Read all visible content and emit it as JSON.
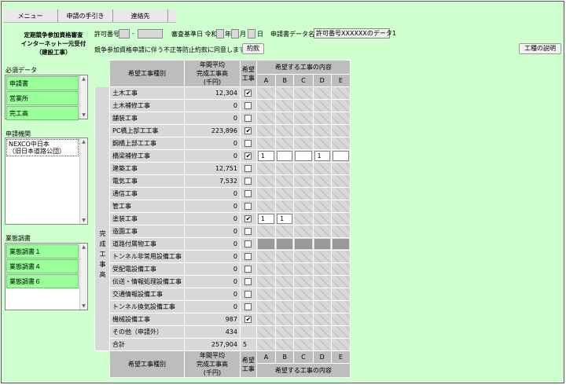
{
  "menu": [
    "メニュー",
    "申請の手引き",
    "連絡先"
  ],
  "header": {
    "title_lines": [
      "定期競争参加資格審査",
      "インターネット一元受付",
      "（建設工事）"
    ],
    "permit_label": "許可番号",
    "permit_dash": "-",
    "date_label": "審査基準日 令和",
    "date_units": [
      "年",
      "月",
      "日"
    ],
    "datafile_label": "申請書データ名",
    "datafile_value": "許可番号XXXXXXのデータ1",
    "consent_text": "競争参加資格申請に伴う不正等防止約款に同意します。",
    "consent_button": "約款",
    "explain_button": "工種の説明"
  },
  "sidebar": {
    "required_title": "必須データ",
    "required_items": [
      "申請書",
      "営業所",
      "完工高"
    ],
    "org_title": "申請機関",
    "org_item": "NEXCO中日本\n（旧日本道路公団）",
    "survey_title": "業態調書",
    "survey_items": [
      "業態調書１",
      "業態調書４",
      "業態調書６"
    ]
  },
  "grid": {
    "head_type": "希望工事種別",
    "head_amount": "年間平均\n完成工事高\n(千円)",
    "head_desired": "希望\n工事",
    "head_contents": "希望する工事の内容",
    "col_letters": [
      "A",
      "B",
      "C",
      "D",
      "E"
    ],
    "side_label": "完成工事高",
    "rows": [
      {
        "name": "土木工事",
        "amount": "12,304",
        "checked": true,
        "cells": "hatch"
      },
      {
        "name": "土木補修工事",
        "amount": "0",
        "checked": false,
        "cells": "hatch"
      },
      {
        "name": "舗装工事",
        "amount": "0",
        "checked": false,
        "cells": "hatch"
      },
      {
        "name": "PC橋上部工工事",
        "amount": "223,896",
        "checked": true,
        "cells": "hatch"
      },
      {
        "name": "鋼橋上部工工事",
        "amount": "0",
        "checked": false,
        "cells": "hatch"
      },
      {
        "name": "橋梁補修工事",
        "amount": "0",
        "checked": true,
        "cells": "input",
        "values": [
          "1",
          "",
          "",
          "1",
          ""
        ]
      },
      {
        "name": "建築工事",
        "amount": "12,751",
        "checked": false,
        "cells": "hatch"
      },
      {
        "name": "電気工事",
        "amount": "7,532",
        "checked": false,
        "cells": "hatch"
      },
      {
        "name": "通信工事",
        "amount": "0",
        "checked": false,
        "cells": "hatch"
      },
      {
        "name": "管工事",
        "amount": "0",
        "checked": false,
        "cells": "hatch"
      },
      {
        "name": "塗装工事",
        "amount": "0",
        "checked": true,
        "cells": "input2",
        "values": [
          "1",
          "1"
        ]
      },
      {
        "name": "造園工事",
        "amount": "0",
        "checked": false,
        "cells": "hatch"
      },
      {
        "name": "道路付属物工事",
        "amount": "0",
        "checked": false,
        "cells": "dark"
      },
      {
        "name": "トンネル非常用設備工事",
        "amount": "0",
        "checked": false,
        "cells": "hatch"
      },
      {
        "name": "受配電設備工事",
        "amount": "0",
        "checked": false,
        "cells": "hatch"
      },
      {
        "name": "伝送・情報処理設備工事",
        "amount": "0",
        "checked": false,
        "cells": "hatch"
      },
      {
        "name": "交通情報設備工事",
        "amount": "0",
        "checked": false,
        "cells": "hatch"
      },
      {
        "name": "トンネル換気設備工事",
        "amount": "0",
        "checked": false,
        "cells": "hatch"
      },
      {
        "name": "機械設備工事",
        "amount": "987",
        "checked": true,
        "cells": "hatch"
      }
    ],
    "other_label": "その他（申請外）",
    "other_amount": "434",
    "total_label": "合計",
    "total_amount": "257,904",
    "total_count": "5"
  }
}
